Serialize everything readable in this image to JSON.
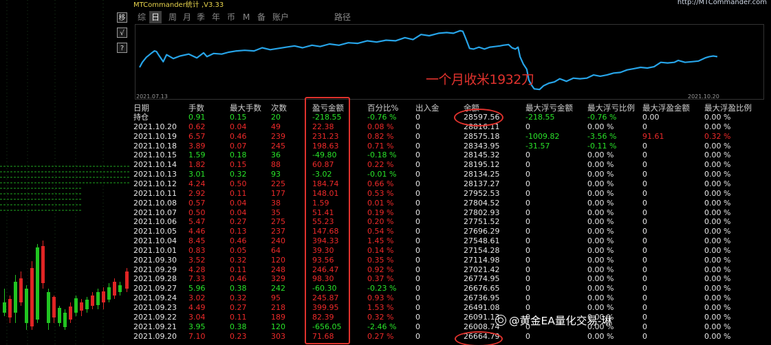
{
  "window": {
    "title": "MTCommander统计 ,V3.33",
    "url": "http://MTCommander.com"
  },
  "side_toolbar": [
    {
      "label": "移"
    },
    {
      "label": "√"
    },
    {
      "label": "?"
    }
  ],
  "tabs": [
    {
      "label": "综",
      "active": false
    },
    {
      "label": "日",
      "active": true
    },
    {
      "label": "周",
      "active": false
    },
    {
      "label": "月",
      "active": false
    },
    {
      "label": "季",
      "active": false
    },
    {
      "label": "年",
      "active": false
    },
    {
      "label": "币",
      "active": false
    },
    {
      "label": "M",
      "active": false
    },
    {
      "label": "备",
      "active": false
    },
    {
      "label": "账户",
      "active": false
    },
    {
      "label": "路径",
      "active": false
    }
  ],
  "chart_data": {
    "type": "line",
    "title": "",
    "xlabel": "",
    "ylabel": "",
    "x_start_label": "2021.07.13",
    "x_end_label": "2021.10.20",
    "color": "#27a4e8",
    "grid": false,
    "ylim": [
      100,
      0
    ],
    "points": [
      [
        0,
        62
      ],
      [
        4,
        54
      ],
      [
        10,
        46
      ],
      [
        17,
        40
      ],
      [
        22,
        36
      ],
      [
        25,
        37
      ],
      [
        28,
        42
      ],
      [
        35,
        53
      ],
      [
        40,
        42
      ],
      [
        50,
        48
      ],
      [
        60,
        44
      ],
      [
        73,
        41
      ],
      [
        85,
        47
      ],
      [
        95,
        39
      ],
      [
        100,
        45
      ],
      [
        110,
        40
      ],
      [
        122,
        41
      ],
      [
        132,
        38
      ],
      [
        144,
        36
      ],
      [
        156,
        35
      ],
      [
        170,
        36
      ],
      [
        182,
        31
      ],
      [
        194,
        34
      ],
      [
        206,
        32
      ],
      [
        218,
        30
      ],
      [
        230,
        28
      ],
      [
        242,
        31
      ],
      [
        256,
        27
      ],
      [
        268,
        29
      ],
      [
        282,
        25
      ],
      [
        296,
        27
      ],
      [
        310,
        23
      ],
      [
        324,
        24
      ],
      [
        338,
        20
      ],
      [
        352,
        22
      ],
      [
        366,
        19
      ],
      [
        380,
        20
      ],
      [
        394,
        15
      ],
      [
        406,
        18
      ],
      [
        418,
        10
      ],
      [
        430,
        12
      ],
      [
        444,
        8
      ],
      [
        456,
        7
      ],
      [
        466,
        8
      ],
      [
        476,
        4
      ],
      [
        480,
        5
      ],
      [
        485,
        18
      ],
      [
        490,
        32
      ],
      [
        496,
        33
      ],
      [
        504,
        30
      ],
      [
        512,
        33
      ],
      [
        520,
        30
      ],
      [
        528,
        29
      ],
      [
        535,
        28
      ],
      [
        540,
        27
      ],
      [
        548,
        26
      ],
      [
        553,
        31
      ],
      [
        558,
        33
      ],
      [
        562,
        30
      ],
      [
        565,
        45
      ],
      [
        570,
        57
      ],
      [
        575,
        65
      ],
      [
        578,
        82
      ],
      [
        582,
        90
      ],
      [
        586,
        96
      ],
      [
        594,
        97
      ],
      [
        600,
        91
      ],
      [
        608,
        87
      ],
      [
        616,
        85
      ],
      [
        624,
        80
      ],
      [
        634,
        84
      ],
      [
        644,
        79
      ],
      [
        654,
        80
      ],
      [
        664,
        79
      ],
      [
        674,
        74
      ],
      [
        684,
        76
      ],
      [
        694,
        74
      ],
      [
        704,
        71
      ],
      [
        714,
        70
      ],
      [
        724,
        66
      ],
      [
        734,
        64
      ],
      [
        744,
        62
      ],
      [
        754,
        63
      ],
      [
        764,
        61
      ],
      [
        774,
        54
      ],
      [
        784,
        55
      ],
      [
        794,
        54
      ],
      [
        800,
        51
      ],
      [
        810,
        54
      ],
      [
        820,
        53
      ],
      [
        830,
        52
      ],
      [
        840,
        47
      ],
      [
        846,
        45
      ],
      [
        852,
        44
      ],
      [
        858,
        45
      ]
    ]
  },
  "annotation": "一个月收米1932刀",
  "watermark": "@黄金EA量化交易-琳",
  "table": {
    "headers": [
      "日期",
      "手数",
      "最大手数",
      "次数",
      "盈亏金额",
      "百分比%",
      "出入金",
      "余额",
      "最大浮亏金额",
      "最大浮亏比例",
      "最大浮盈金额",
      "最大浮盈比例"
    ],
    "rows": [
      {
        "cells": [
          "持仓",
          "0.91",
          "0.15",
          "20",
          "-218.55",
          "-0.76 %",
          "0",
          "28597.56",
          "-218.55",
          "-0.76 %",
          "0.00",
          "0.00 %"
        ],
        "tone": "summary"
      },
      {
        "cells": [
          "2021.10.20",
          "0.62",
          "0.04",
          "49",
          "22.38",
          "0.08 %",
          "0",
          "28816.11",
          "0",
          "0.00 %",
          "0",
          "0.00 %"
        ],
        "tone": "up"
      },
      {
        "cells": [
          "2021.10.19",
          "6.57",
          "0.46",
          "239",
          "231.23",
          "0.82 %",
          "0",
          "28575.18",
          "-1009.82",
          "-3.56 %",
          "91.61",
          "0.32 %"
        ],
        "tone": "up"
      },
      {
        "cells": [
          "2021.10.18",
          "3.89",
          "0.07",
          "245",
          "198.63",
          "0.71 %",
          "0",
          "28343.95",
          "-31.57",
          "-0.11 %",
          "0",
          "0.00 %"
        ],
        "tone": "up"
      },
      {
        "cells": [
          "2021.10.15",
          "1.59",
          "0.18",
          "36",
          "-49.80",
          "-0.18 %",
          "0",
          "28145.32",
          "0",
          "0.00 %",
          "0",
          "0.00 %"
        ],
        "tone": "down"
      },
      {
        "cells": [
          "2021.10.14",
          "1.82",
          "0.15",
          "88",
          "60.87",
          "0.22 %",
          "0",
          "28195.12",
          "0",
          "0.00 %",
          "0",
          "0.00 %"
        ],
        "tone": "up"
      },
      {
        "cells": [
          "2021.10.13",
          "3.01",
          "0.32",
          "93",
          "-3.02",
          "-0.01 %",
          "0",
          "28134.25",
          "0",
          "0.00 %",
          "0",
          "0.00 %"
        ],
        "tone": "down"
      },
      {
        "cells": [
          "2021.10.12",
          "4.24",
          "0.50",
          "225",
          "184.74",
          "0.66 %",
          "0",
          "28137.27",
          "0",
          "0.00 %",
          "0",
          "0.00 %"
        ],
        "tone": "up"
      },
      {
        "cells": [
          "2021.10.11",
          "2.92",
          "0.11",
          "177",
          "148.01",
          "0.53 %",
          "0",
          "27952.53",
          "0",
          "0.00 %",
          "0",
          "0.00 %"
        ],
        "tone": "up"
      },
      {
        "cells": [
          "2021.10.08",
          "0.57",
          "0.04",
          "38",
          "1.59",
          "0.01 %",
          "0",
          "27804.52",
          "0",
          "0.00 %",
          "0",
          "0.00 %"
        ],
        "tone": "up"
      },
      {
        "cells": [
          "2021.10.07",
          "0.50",
          "0.04",
          "35",
          "51.41",
          "0.19 %",
          "0",
          "27802.93",
          "0",
          "0.00 %",
          "0",
          "0.00 %"
        ],
        "tone": "up"
      },
      {
        "cells": [
          "2021.10.06",
          "5.47",
          "0.27",
          "275",
          "55.23",
          "0.20 %",
          "0",
          "27751.52",
          "0",
          "0.00 %",
          "0",
          "0.00 %"
        ],
        "tone": "up"
      },
      {
        "cells": [
          "2021.10.05",
          "4.46",
          "0.13",
          "237",
          "147.68",
          "0.54 %",
          "0",
          "27696.29",
          "0",
          "0.00 %",
          "0",
          "0.00 %"
        ],
        "tone": "up"
      },
      {
        "cells": [
          "2021.10.04",
          "8.45",
          "0.46",
          "240",
          "394.33",
          "1.45 %",
          "0",
          "27548.61",
          "0",
          "0.00 %",
          "0",
          "0.00 %"
        ],
        "tone": "up"
      },
      {
        "cells": [
          "2021.10.01",
          "0.83",
          "0.05",
          "64",
          "39.30",
          "0.14 %",
          "0",
          "27154.28",
          "0",
          "0.00 %",
          "0",
          "0.00 %"
        ],
        "tone": "up"
      },
      {
        "cells": [
          "2021.09.30",
          "3.52",
          "0.32",
          "120",
          "93.56",
          "0.35 %",
          "0",
          "27114.98",
          "0",
          "0.00 %",
          "0",
          "0.00 %"
        ],
        "tone": "up"
      },
      {
        "cells": [
          "2021.09.29",
          "4.28",
          "0.11",
          "248",
          "246.47",
          "0.92 %",
          "0",
          "27021.42",
          "0",
          "0.00 %",
          "0",
          "0.00 %"
        ],
        "tone": "up"
      },
      {
        "cells": [
          "2021.09.28",
          "7.33",
          "0.46",
          "329",
          "98.30",
          "0.37 %",
          "0",
          "26774.95",
          "0",
          "0.00 %",
          "0",
          "0.00 %"
        ],
        "tone": "up"
      },
      {
        "cells": [
          "2021.09.27",
          "5.96",
          "0.38",
          "242",
          "-60.30",
          "-0.23 %",
          "0",
          "26676.65",
          "0",
          "0.00 %",
          "0",
          "0.00 %"
        ],
        "tone": "down"
      },
      {
        "cells": [
          "2021.09.24",
          "3.02",
          "0.32",
          "95",
          "245.87",
          "0.93 %",
          "0",
          "26736.95",
          "0",
          "0.00 %",
          "0",
          "0.00 %"
        ],
        "tone": "up"
      },
      {
        "cells": [
          "2021.09.23",
          "4.49",
          "0.27",
          "218",
          "399.95",
          "1.53 %",
          "0",
          "26491.08",
          "0",
          "0.00 %",
          "0",
          "0.00 %"
        ],
        "tone": "up"
      },
      {
        "cells": [
          "2021.09.22",
          "3.04",
          "0.11",
          "189",
          "82.39",
          "0.32 %",
          "0",
          "26091.13",
          "0",
          "0.00 %",
          "0",
          "0.00 %"
        ],
        "tone": "up"
      },
      {
        "cells": [
          "2021.09.21",
          "3.95",
          "0.38",
          "120",
          "-656.05",
          "-2.46 %",
          "0",
          "26008.74",
          "0",
          "0.00 %",
          "0",
          "0.00 %"
        ],
        "tone": "down"
      },
      {
        "cells": [
          "2021.09.20",
          "7.10",
          "0.23",
          "303",
          "71.68",
          "0.27 %",
          "0",
          "26664.79",
          "0",
          "0.00 %",
          "0",
          "0.00 %"
        ],
        "tone": "up"
      }
    ]
  }
}
